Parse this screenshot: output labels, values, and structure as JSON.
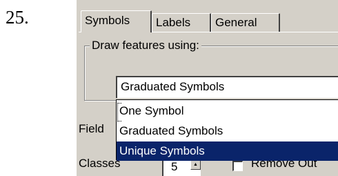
{
  "step_number": "25.",
  "tabs": [
    {
      "label": "Symbols",
      "active": true
    },
    {
      "label": "Labels",
      "active": false
    },
    {
      "label": "General",
      "active": false
    }
  ],
  "group": {
    "legend": "Draw features using:",
    "combo_value": "Graduated Symbols",
    "options": [
      "One Symbol",
      "Graduated Symbols",
      "Unique Symbols"
    ],
    "highlighted_option": "Unique Symbols"
  },
  "field_label": "Field",
  "classes_label": "Classes",
  "classes_value": "5",
  "remove_checkbox_label": "Remove Out",
  "colors": {
    "highlight": "#0a246a",
    "dialog_face": "#d4d0c8"
  }
}
